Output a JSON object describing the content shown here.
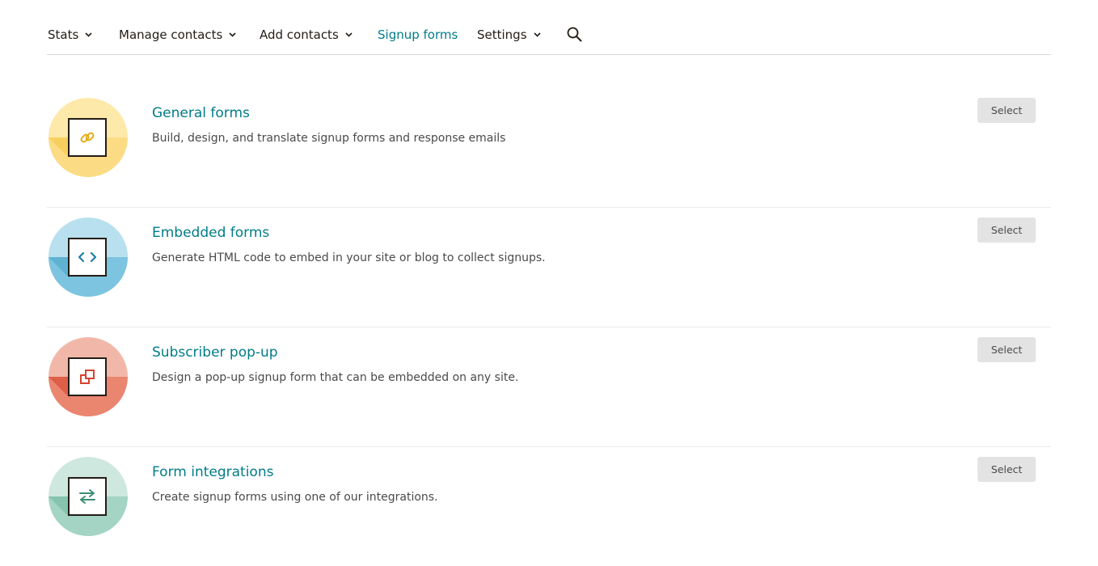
{
  "nav": {
    "items": [
      {
        "label": "Stats",
        "has_dropdown": true,
        "active": false
      },
      {
        "label": "Manage contacts",
        "has_dropdown": true,
        "active": false
      },
      {
        "label": "Add contacts",
        "has_dropdown": true,
        "active": false
      },
      {
        "label": "Signup forms",
        "has_dropdown": false,
        "active": true
      },
      {
        "label": "Settings",
        "has_dropdown": true,
        "active": false
      }
    ],
    "search_icon": "search-icon",
    "active_color": "#007c89"
  },
  "forms": [
    {
      "title": "General forms",
      "description": "Build, design, and translate signup forms and response emails",
      "select_label": "Select",
      "icon": "link-icon",
      "colors": {
        "light": "#fde9a9",
        "dark": "#fbdc85",
        "wedge": "#f7cf5e",
        "glyph": "#e4ac12"
      }
    },
    {
      "title": "Embedded forms",
      "description": "Generate HTML code to embed in your site or blog to collect signups.",
      "select_label": "Select",
      "icon": "code-icon",
      "colors": {
        "light": "#b8e0ee",
        "dark": "#7cc4df",
        "wedge": "#5fb2d2",
        "glyph": "#1f7fa6"
      }
    },
    {
      "title": "Subscriber pop-up",
      "description": "Design a pop-up signup form that can be embedded on any site.",
      "select_label": "Select",
      "icon": "popup-icon",
      "colors": {
        "light": "#f1b8a9",
        "dark": "#ea8570",
        "wedge": "#de5f48",
        "glyph": "#d4432d"
      }
    },
    {
      "title": "Form integrations",
      "description": "Create signup forms using one of our integrations.",
      "select_label": "Select",
      "icon": "swap-arrows-icon",
      "colors": {
        "light": "#cfe8df",
        "dark": "#a3d4c4",
        "wedge": "#86c4b0",
        "glyph": "#3c8f72"
      }
    }
  ]
}
